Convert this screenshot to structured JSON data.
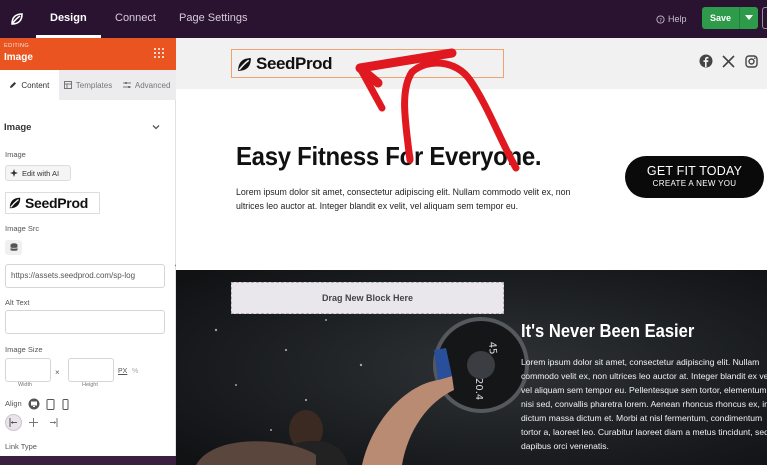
{
  "topbar": {
    "tabs": [
      {
        "label": "Design",
        "active": true
      },
      {
        "label": "Connect",
        "active": false
      },
      {
        "label": "Page Settings",
        "active": false
      }
    ],
    "help_label": "Help",
    "save_label": "Save"
  },
  "sidebar": {
    "editing_small": "EDITING",
    "editing_title": "Image",
    "subtabs": [
      {
        "label": "Content",
        "icon": "pencil-icon",
        "active": true
      },
      {
        "label": "Templates",
        "icon": "template-icon",
        "active": false
      },
      {
        "label": "Advanced",
        "icon": "sliders-icon",
        "active": false
      }
    ],
    "section_title": "Image",
    "image_label": "Image",
    "ai_button": "Edit with AI",
    "preview_logo_text": "SeedProd",
    "image_src_label": "Image Src",
    "image_src_value": "https://assets.seedprod.com/sp-log",
    "alt_text_label": "Alt Text",
    "alt_text_value": "",
    "image_size_label": "Image Size",
    "width_caption": "Width",
    "height_caption": "Height",
    "size_separator": "×",
    "unit_px": "PX",
    "unit_pct": "%",
    "align_label": "Align",
    "link_type_label": "Link Type"
  },
  "canvas": {
    "logo_text": "SeedProd",
    "social_icons": [
      "facebook-icon",
      "x-icon",
      "instagram-icon"
    ],
    "hero_title": "Easy Fitness For Everyone.",
    "hero_text": "Lorem ipsum dolor sit amet, consectetur adipiscing elit. Nullam commodo velit ex, non ultrices leo auctor at. Integer blandit ex velit, vel aliquam sem tempor eu.",
    "cta_line1": "GET FIT TODAY",
    "cta_line2": "CREATE A NEW YOU",
    "drop_zone": "Drag New Block Here",
    "section_title": "It's Never Been Easier",
    "section_text": "Lorem ipsum dolor sit amet, consectetur adipiscing elit. Nullam commodo velit ex, non ultrices leo auctor at. Integer blandit ex velit, vel aliquam sem tempor eu. Pellentesque sem tortor, elementum et nisi sed, convallis pharetra lorem. Aenean rhoncus rhoncus ex, in dictum massa dictum et. Morbi at nisl fermentum, condimentum tortor a, laoreet leo. Curabitur laoreet diam a metus tincidunt, sed dapibus orci venenatis.",
    "plate_numbers": [
      "45",
      "20.4"
    ]
  },
  "colors": {
    "topbar": "#2a1331",
    "editing_header": "#e95420",
    "save_button": "#2d9b4a",
    "selection_outline": "#f0a271",
    "annotation_arrow": "#e0181f",
    "dark_section": "#1b1d1f"
  }
}
